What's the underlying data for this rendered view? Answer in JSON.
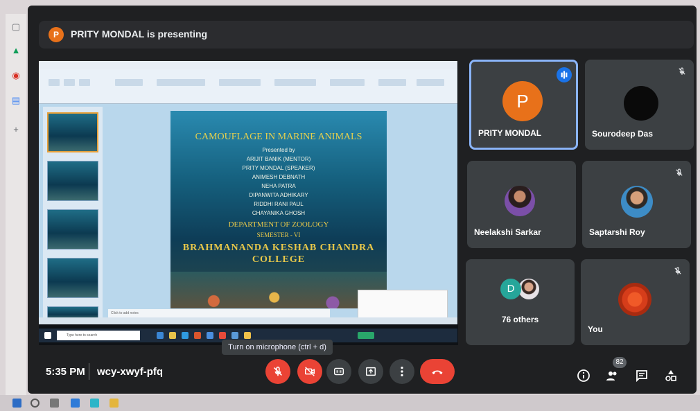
{
  "presenter": {
    "initial": "P",
    "banner": "PRITY MONDAL is presenting"
  },
  "slide": {
    "title": "CAMOUFLAGE IN MARINE ANIMALS",
    "lines": [
      "Presented by",
      "ARIJIT BANIK (MENTOR)",
      "PRITY MONDAL (SPEAKER)",
      "ANIMESH DEBNATH",
      "NEHA PATRA",
      "DIPANWITA ADHIKARY",
      "RIDDHI RANI PAUL",
      "CHAYANIKA GHOSH"
    ],
    "department": "DEPARTMENT OF ZOOLOGY",
    "semester": "SEMESTER - VI",
    "college_line1": "BRAHMANANDA KESHAB CHANDRA",
    "college_line2": "COLLEGE"
  },
  "ppt": {
    "notes_placeholder": "Click to add notes",
    "search_placeholder": "Type here to search"
  },
  "participants": {
    "p1": {
      "initial": "P",
      "name": "PRITY MONDAL"
    },
    "p2": {
      "name": "Sourodeep Das"
    },
    "p3": {
      "name": "Neelakshi Sarkar"
    },
    "p4": {
      "name": "Saptarshi Roy"
    },
    "p5": {
      "initial": "D",
      "label": "76 others"
    },
    "p6": {
      "name": "You"
    }
  },
  "controls": {
    "tooltip": "Turn on microphone (ctrl + d)",
    "time": "5:35 PM",
    "meeting_code": "wcy-xwyf-pfq",
    "people_count": "82"
  },
  "colors": {
    "accent_orange": "#e8711a",
    "control_red": "#ea4335",
    "active_border": "#8ab4f8"
  }
}
